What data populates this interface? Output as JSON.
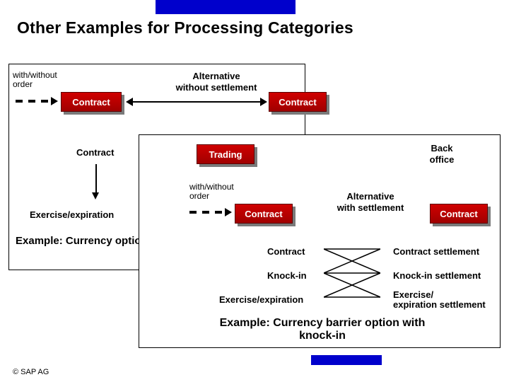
{
  "title": "Other Examples for Processing Categories",
  "copyright": "©  SAP AG",
  "panel1": {
    "withWithout": "with/without\norder",
    "contractA": "Contract",
    "alternative": "Alternative\nwithout settlement",
    "contractB": "Contract",
    "contract2": "Contract",
    "exercise": "Exercise/expiration",
    "example": "Example: Currency option"
  },
  "panel2": {
    "trading": "Trading",
    "backOffice": "Back\noffice",
    "withWithout": "with/without\norder",
    "contractC": "Contract",
    "altSettle": "Alternative\nwith settlement",
    "contractD": "Contract",
    "row1L": "Contract",
    "row1R": "Contract settlement",
    "row2L": "Knock-in",
    "row2R": "Knock-in settlement",
    "row3L": "Exercise/expiration",
    "row3R": "Exercise/\nexpiration settlement",
    "example": "Example: Currency barrier option with\nknock-in"
  }
}
